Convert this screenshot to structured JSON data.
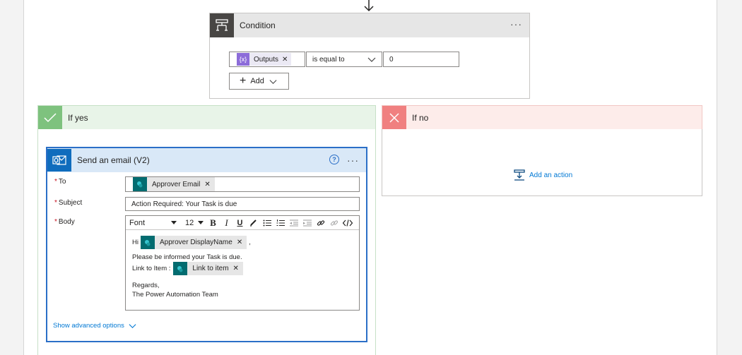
{
  "condition": {
    "title": "Condition",
    "operand_token": "Outputs",
    "operator": "is equal to",
    "value": "0",
    "add_label": "Add"
  },
  "branches": {
    "yes_title": "If yes",
    "no_title": "If no",
    "add_action_label": "Add an action"
  },
  "email_action": {
    "title": "Send an email (V2)",
    "to_label": "To",
    "to_token": "Approver Email",
    "subject_label": "Subject",
    "subject_value": "Action Required: Your Task is due",
    "body_label": "Body",
    "toolbar": {
      "font": "Font",
      "size": "12"
    },
    "body": {
      "greeting": "Hi",
      "name_token": "Approver DisplayName",
      "after_token": ",",
      "line1": "Please be informed your Task is due.",
      "link_prefix": "Link to Item :",
      "link_token": "Link to item",
      "regards": "Regards,",
      "signature": "The Power Automation Team"
    },
    "advanced_label": "Show advanced options"
  },
  "colors": {
    "accent": "#0078d4",
    "yes_green": "#7ec27e",
    "no_red": "#f08080",
    "outlook_blue": "#0f6cbd",
    "sharepoint_teal": "#036c70",
    "expression_purple": "#8c6cd9"
  }
}
